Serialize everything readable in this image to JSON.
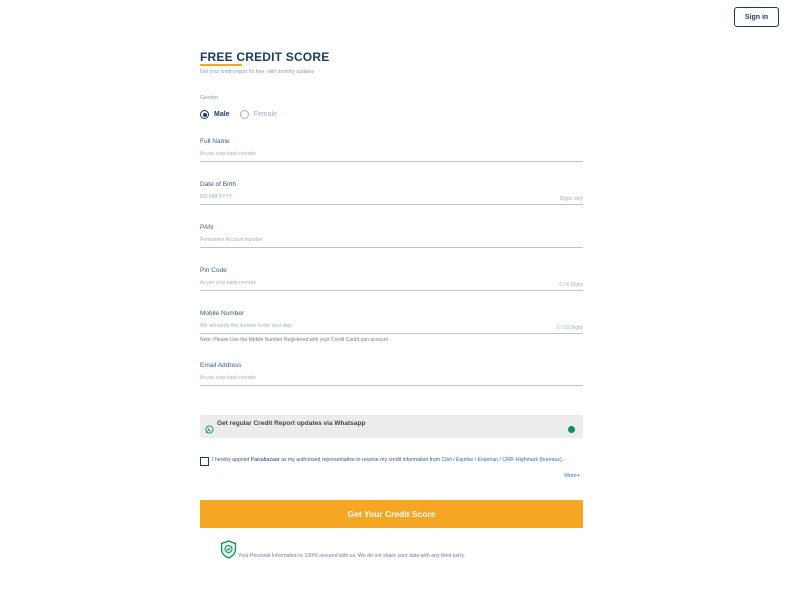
{
  "header": {
    "signin_label": "Sign in"
  },
  "form": {
    "title": "FREE CREDIT SCORE",
    "subtitle": "Get your credit report for free, with monthly updates",
    "gender": {
      "label": "Gender",
      "options": [
        "Male",
        "Female"
      ],
      "selected": "Male"
    },
    "fields": [
      {
        "label": "Full Name",
        "placeholder": "As per your bank records",
        "hint": ""
      },
      {
        "label": "Date of Birth",
        "placeholder": "DD-MM-YYYY",
        "hint": "Digits only"
      },
      {
        "label": "PAN",
        "placeholder": "Permanent Account Number",
        "hint": ""
      },
      {
        "label": "Pin Code",
        "placeholder": "As per your bank records",
        "hint": "0 / 6 Digits"
      },
      {
        "label": "Mobile Number",
        "placeholder": "We will verify this number in the next step",
        "hint": "0 / 10 Digits"
      },
      {
        "label": "Email Address",
        "placeholder": "As per your bank records",
        "hint": ""
      }
    ],
    "mobile_note": "Note: Please Use the Mobile Number Registered with your Credit Card/Loan account",
    "whatsapp": {
      "text": "Get regular Credit Report updates via Whatsapp",
      "enabled": true,
      "toggle_color": "#0a8f5a"
    },
    "consent": {
      "prefix": "I hereby appoint ",
      "brand": "Paisabazaar",
      "middle": " as my authorised representative to receive my credit information from ",
      "bureaus": "Cibil / Equifax / Experian / CRIF Highmark (bureaus).",
      "checked": false,
      "more_label": "More+"
    },
    "cta_label": "Get Your Credit Score",
    "secure_text": "Your Personal Information is 100% secured with us. We do not share your data with any third party."
  },
  "colors": {
    "primary": "#1b3b5f",
    "accent": "#f5a623",
    "link": "#2d6fc5",
    "success": "#0a8f5a"
  },
  "icons": {
    "whatsapp": "whatsapp-icon",
    "shield": "shield-check-icon"
  }
}
